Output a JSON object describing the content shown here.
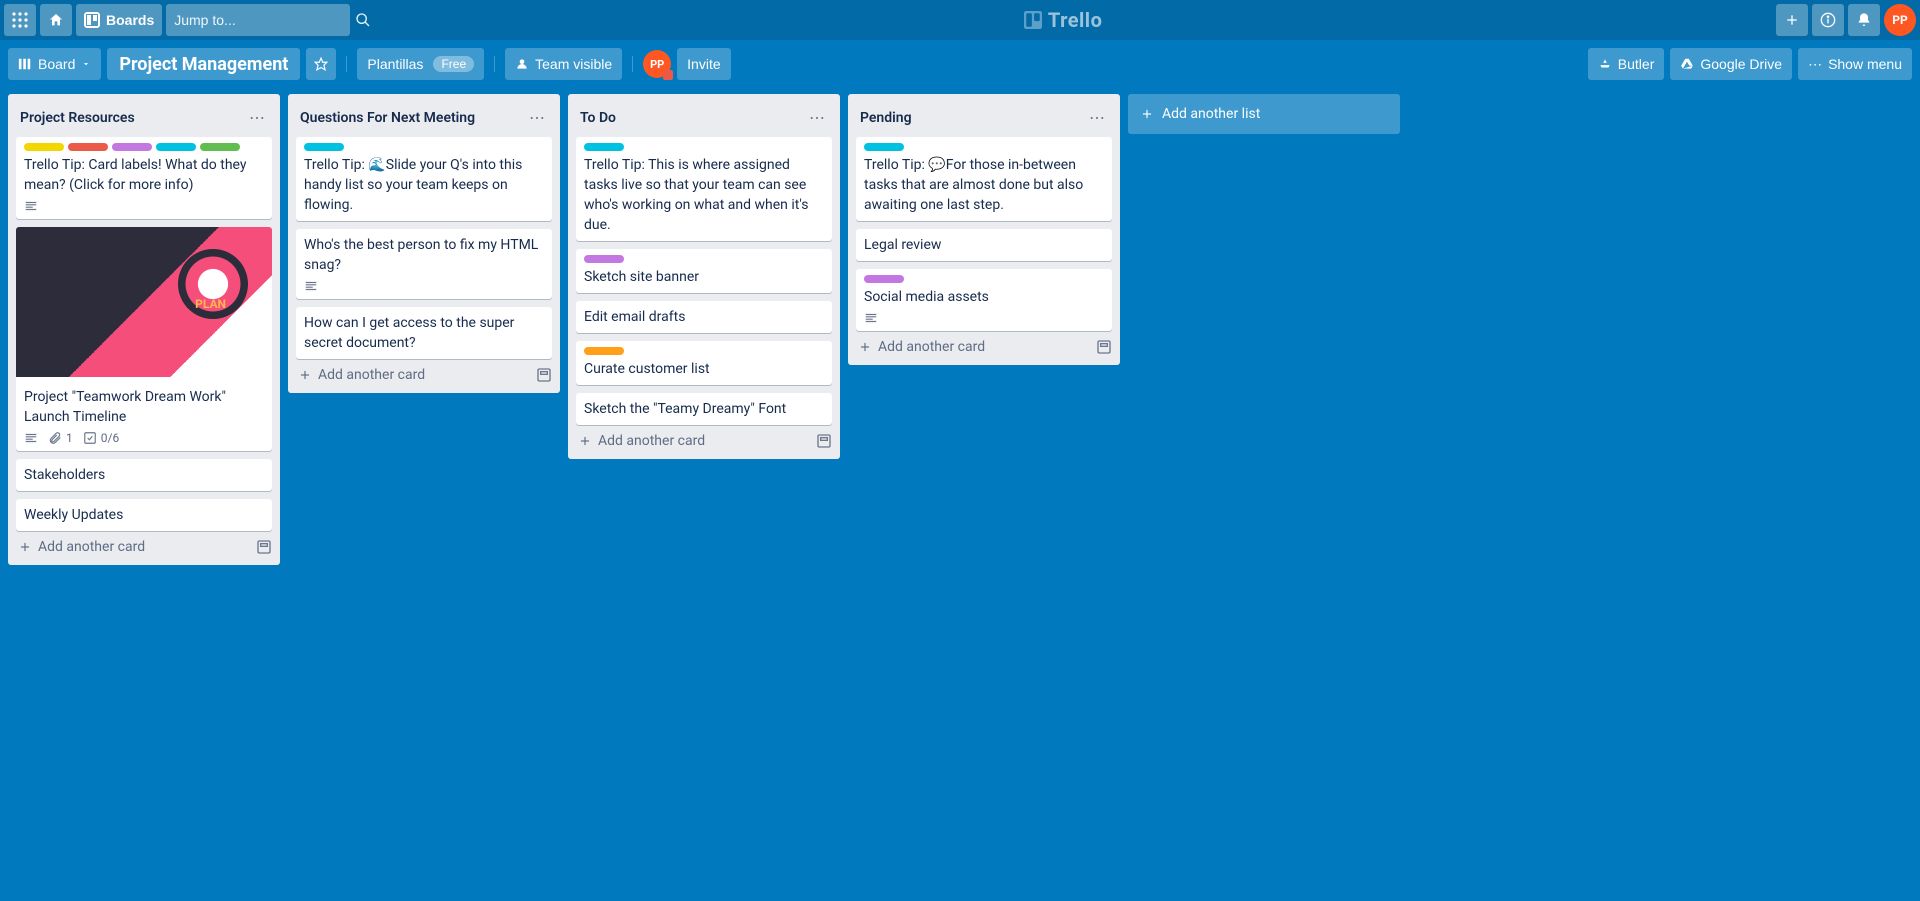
{
  "topbar": {
    "boards_label": "Boards",
    "search_placeholder": "Jump to...",
    "brand": "Trello",
    "avatar_initials": "PP"
  },
  "boardbar": {
    "view_label": "Board",
    "board_name": "Project Management",
    "templates_label": "Plantillas",
    "free_label": "Free",
    "visibility_label": "Team visible",
    "invite_label": "Invite",
    "member_initials": "PP",
    "butler_label": "Butler",
    "gdrive_label": "Google Drive",
    "show_menu_label": "Show menu"
  },
  "lists": [
    {
      "title": "Project Resources",
      "cards": [
        {
          "labels": [
            "yellow",
            "red",
            "purple",
            "teal",
            "green"
          ],
          "title": "Trello Tip: Card labels! What do they mean? (Click for more info)",
          "badges": {
            "desc": true
          }
        },
        {
          "cover": true,
          "title": "Project \"Teamwork Dream Work\" Launch Timeline",
          "badges": {
            "desc": true,
            "attachments": "1",
            "checklist": "0/6"
          }
        },
        {
          "title": "Stakeholders"
        },
        {
          "title": "Weekly Updates"
        }
      ],
      "add_label": "Add another card"
    },
    {
      "title": "Questions For Next Meeting",
      "cards": [
        {
          "labels": [
            "teal"
          ],
          "title": "Trello Tip: 🌊Slide your Q's into this handy list so your team keeps on flowing."
        },
        {
          "title": "Who's the best person to fix my HTML snag?",
          "badges": {
            "desc": true
          }
        },
        {
          "title": "How can I get access to the super secret document?"
        }
      ],
      "add_label": "Add another card"
    },
    {
      "title": "To Do",
      "cards": [
        {
          "labels": [
            "teal"
          ],
          "title": "Trello Tip: This is where assigned tasks live so that your team can see who's working on what and when it's due."
        },
        {
          "labels": [
            "purple"
          ],
          "title": "Sketch site banner"
        },
        {
          "title": "Edit email drafts"
        },
        {
          "labels": [
            "orange"
          ],
          "title": "Curate customer list"
        },
        {
          "title": "Sketch the \"Teamy Dreamy\" Font"
        }
      ],
      "add_label": "Add another card"
    },
    {
      "title": "Pending",
      "cards": [
        {
          "labels": [
            "teal"
          ],
          "title": "Trello Tip: 💬For those in-between tasks that are almost done but also awaiting one last step."
        },
        {
          "title": "Legal review"
        },
        {
          "labels": [
            "purple"
          ],
          "title": "Social media assets",
          "badges": {
            "desc": true
          }
        }
      ],
      "add_label": "Add another card"
    }
  ],
  "add_list_label": "Add another list"
}
